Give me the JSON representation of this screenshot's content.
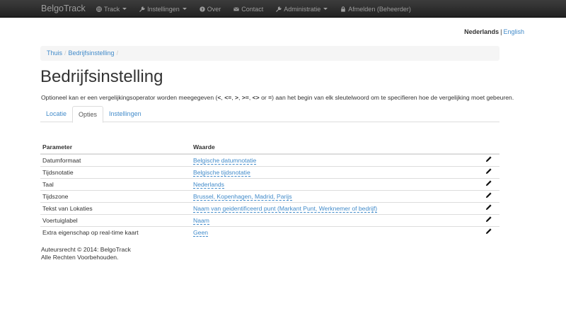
{
  "navbar": {
    "brand": "BelgoTrack",
    "items": [
      {
        "label": "Track",
        "icon": "globe-icon",
        "dropdown": true
      },
      {
        "label": "Instellingen",
        "icon": "wrench-icon",
        "dropdown": true
      },
      {
        "label": "Over",
        "icon": "question-circle-icon",
        "dropdown": false
      },
      {
        "label": "Contact",
        "icon": "envelope-icon",
        "dropdown": false
      },
      {
        "label": "Administratie",
        "icon": "wrench-icon",
        "dropdown": true
      },
      {
        "label": "Afmelden (Beheerder)",
        "icon": "lock-icon",
        "dropdown": false
      }
    ]
  },
  "language": {
    "active": "Nederlands",
    "separator": "|",
    "other": "English"
  },
  "breadcrumb": {
    "items": [
      "Thuis",
      "Bedrijfsinstelling"
    ],
    "separator": "/"
  },
  "page": {
    "title": "Bedrijfsinstelling",
    "intro_prefix": "Optioneel kan er een vergelijkingsoperator worden meegegeven (",
    "ops": [
      "<",
      "<=",
      ">",
      ">=",
      "<>",
      "="
    ],
    "op_separator": ", ",
    "op_or": " or ",
    "intro_suffix": ") aan het begin van elk sleutelwoord om te specifieren hoe de vergelijking moet gebeuren."
  },
  "tabs": [
    {
      "label": "Locatie",
      "active": false
    },
    {
      "label": "Opties",
      "active": true
    },
    {
      "label": "Instellingen",
      "active": false
    }
  ],
  "table": {
    "headers": {
      "parameter": "Parameter",
      "value": "Waarde"
    },
    "rows": [
      {
        "parameter": "Datumformaat",
        "value": "Belgische datumnotatie"
      },
      {
        "parameter": "Tijdsnotatie",
        "value": "Belgische tijdsnotatie"
      },
      {
        "parameter": "Taal",
        "value": "Nederlands"
      },
      {
        "parameter": "Tijdszone",
        "value": "Brussel, Kopenhagen, Madrid, Parijs"
      },
      {
        "parameter": "Tekst van Lokaties",
        "value": "Naam van geidentificeerd punt (Markant Punt, Werknemer of bedrijf)"
      },
      {
        "parameter": "Voertuiglabel",
        "value": "Naam"
      },
      {
        "parameter": "Extra eigenschap op real-time kaart",
        "value": "Geen"
      }
    ]
  },
  "footer": {
    "line1": "Auteursrecht © 2014: BelgoTrack",
    "line2": "Alle Rechten Voorbehouden."
  },
  "colors": {
    "navbar_bg": "#222222",
    "navbar_text": "#9d9d9d",
    "link": "#428bca",
    "breadcrumb_bg": "#f5f5f5"
  }
}
